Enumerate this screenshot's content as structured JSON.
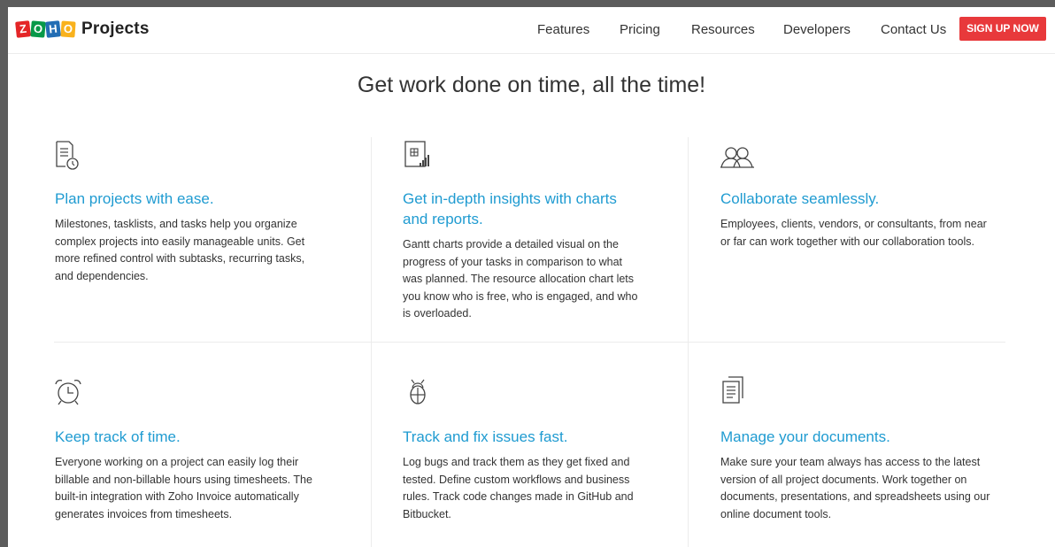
{
  "header": {
    "logo_letters": [
      "Z",
      "O",
      "H",
      "O"
    ],
    "logo_colors": [
      "#e42527",
      "#089949",
      "#226db4",
      "#f9b21d"
    ],
    "product_name": "Projects",
    "nav": [
      "Features",
      "Pricing",
      "Resources",
      "Developers",
      "Contact Us"
    ],
    "signup_label": "SIGN UP NOW",
    "signup_color": "#e8393b"
  },
  "hero": {
    "title": "Get work done on time, all the time!"
  },
  "accent_color": "#1f9bd1",
  "features": [
    {
      "icon": "tasklist-clock-icon",
      "title": "Plan projects with ease.",
      "desc_lines": [
        "Milestones, tasklists, and tasks help you organize",
        "complex projects into easily manageable units. Get",
        "more refined control with subtasks, recurring tasks,",
        "and dependencies."
      ]
    },
    {
      "icon": "chart-report-icon",
      "title_lines": [
        "Get in-depth insights with charts",
        "and reports."
      ],
      "desc_lines": [
        "Gantt charts provide a detailed visual on the",
        "progress of your tasks in comparison to what",
        "was planned. The resource allocation chart lets",
        "you know who is free, who is engaged, and who",
        "is overloaded."
      ]
    },
    {
      "icon": "people-collaborate-icon",
      "title": "Collaborate seamlessly.",
      "desc_lines": [
        "Employees, clients, vendors, or consultants, from near",
        "or far can work together with our collaboration tools."
      ]
    },
    {
      "icon": "alarm-clock-icon",
      "title": "Keep track of time.",
      "desc_lines": [
        "Everyone working on a project can easily log their",
        "billable and non-billable hours using timesheets. The",
        "built-in integration with Zoho Invoice automatically",
        "generates invoices from timesheets."
      ]
    },
    {
      "icon": "bug-icon",
      "title": "Track and fix issues fast.",
      "desc_lines": [
        "Log bugs and track them as they get fixed and",
        "tested. Define custom workflows and business",
        "rules. Track code changes made in GitHub and",
        "Bitbucket."
      ]
    },
    {
      "icon": "documents-icon",
      "title": "Manage your documents.",
      "desc_lines": [
        "Make sure your team always has access to the latest",
        "version of all project documents. Work together on",
        "documents, presentations, and spreadsheets using our",
        "online document tools."
      ]
    }
  ]
}
